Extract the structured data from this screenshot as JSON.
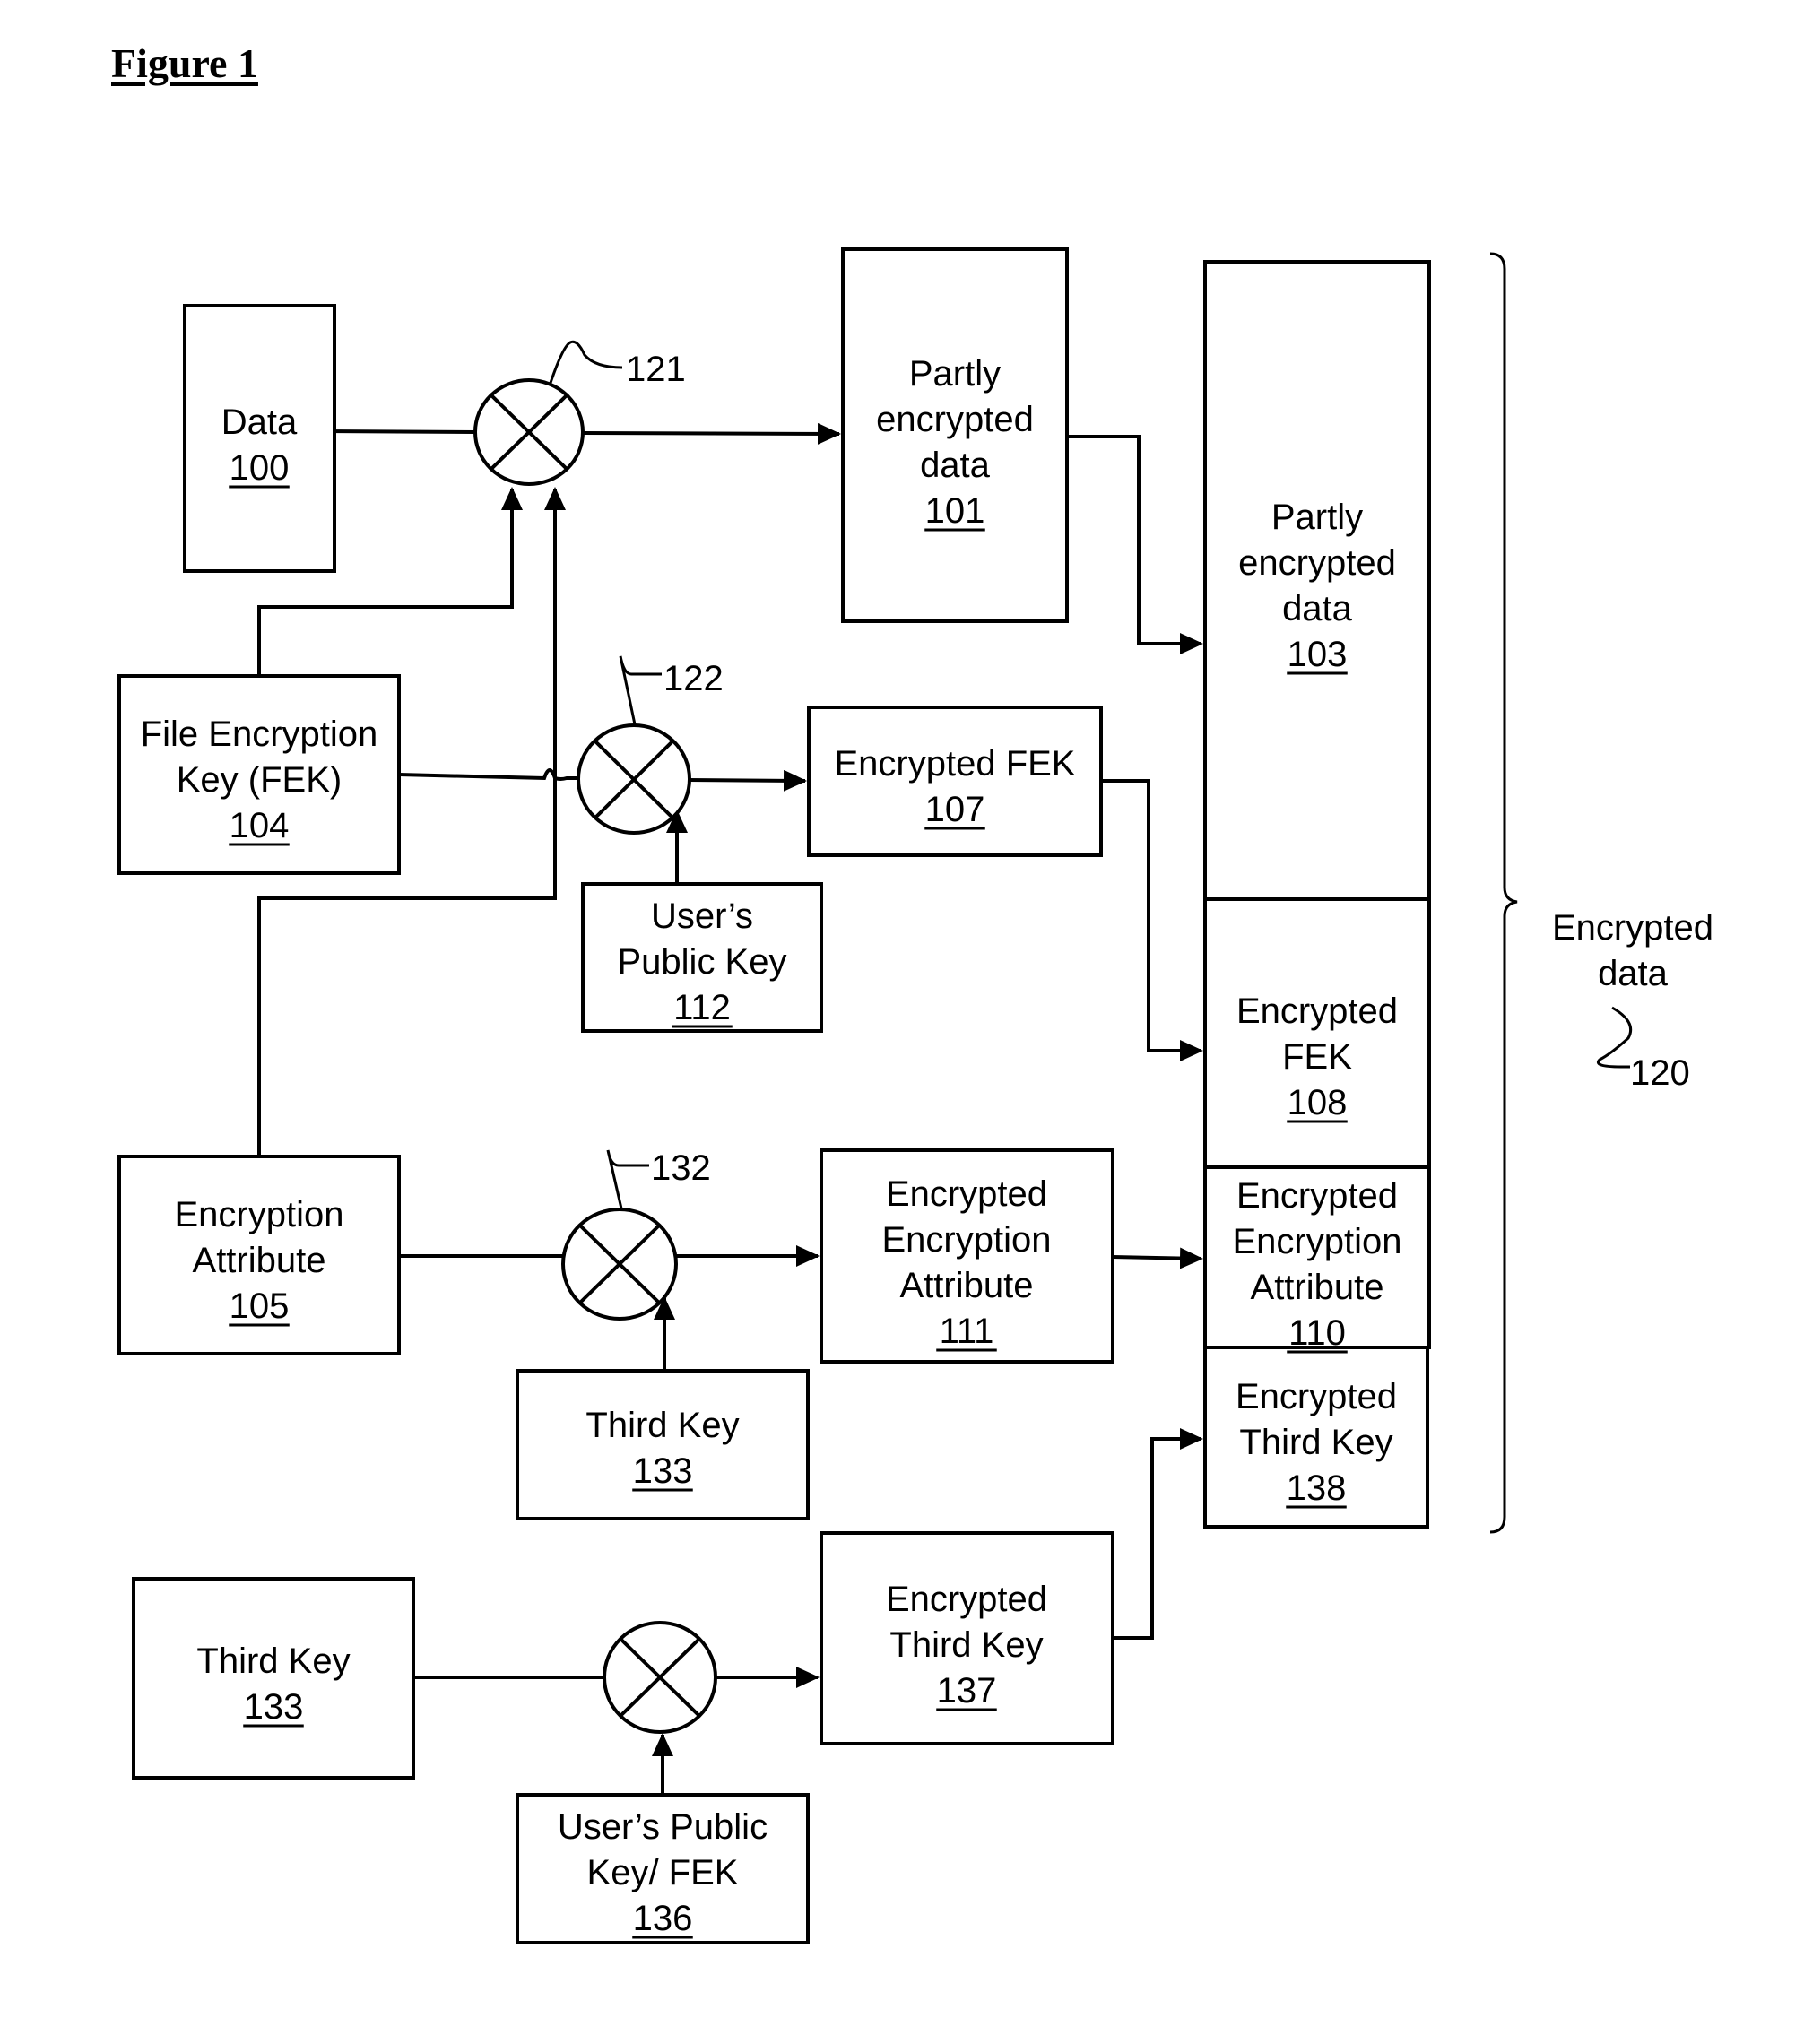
{
  "figure_title": "Figure 1",
  "blocks": {
    "data_100": {
      "lines": [
        "Data"
      ],
      "ref": "100"
    },
    "partly_encrypted_101": {
      "lines": [
        "Partly",
        "encrypted",
        "data"
      ],
      "ref": "101"
    },
    "partly_encrypted_103": {
      "lines": [
        "Partly",
        "encrypted",
        "data"
      ],
      "ref": "103"
    },
    "fek_104": {
      "lines": [
        "File Encryption",
        "Key (FEK)"
      ],
      "ref": "104"
    },
    "encrypted_fek_107": {
      "lines": [
        "Encrypted FEK"
      ],
      "ref": "107"
    },
    "users_public_key_112": {
      "lines": [
        "User’s",
        "Public Key"
      ],
      "ref": "112"
    },
    "encrypted_fek_108": {
      "lines": [
        "Encrypted",
        "FEK"
      ],
      "ref": "108"
    },
    "encryption_attribute_105": {
      "lines": [
        "Encryption",
        "Attribute"
      ],
      "ref": "105"
    },
    "encrypted_encryption_attribute_111": {
      "lines": [
        "Encrypted",
        "Encryption",
        "Attribute"
      ],
      "ref": "111"
    },
    "encrypted_encryption_attribute_110": {
      "lines": [
        "Encrypted",
        "Encryption",
        "Attribute"
      ],
      "ref": "110"
    },
    "encrypted_third_key_138": {
      "lines": [
        "Encrypted",
        "Third Key"
      ],
      "ref": "138"
    },
    "third_key_133_top": {
      "lines": [
        "Third Key"
      ],
      "ref": "133"
    },
    "third_key_133_bottom": {
      "lines": [
        "Third Key"
      ],
      "ref": "133"
    },
    "encrypted_third_key_137": {
      "lines": [
        "Encrypted",
        "Third Key"
      ],
      "ref": "137"
    },
    "users_public_key_fek_136": {
      "lines": [
        "User’s Public",
        "Key/ FEK"
      ],
      "ref": "136"
    }
  },
  "operators": {
    "op_121": {
      "ref": "121",
      "symbol": "multiply-circle"
    },
    "op_122": {
      "ref": "122",
      "symbol": "multiply-circle"
    },
    "op_132": {
      "ref": "132",
      "symbol": "multiply-circle"
    },
    "op_bottom": {
      "ref": "",
      "symbol": "multiply-circle"
    }
  },
  "group": {
    "lines": [
      "Encrypted",
      "data"
    ],
    "ref": "120"
  }
}
